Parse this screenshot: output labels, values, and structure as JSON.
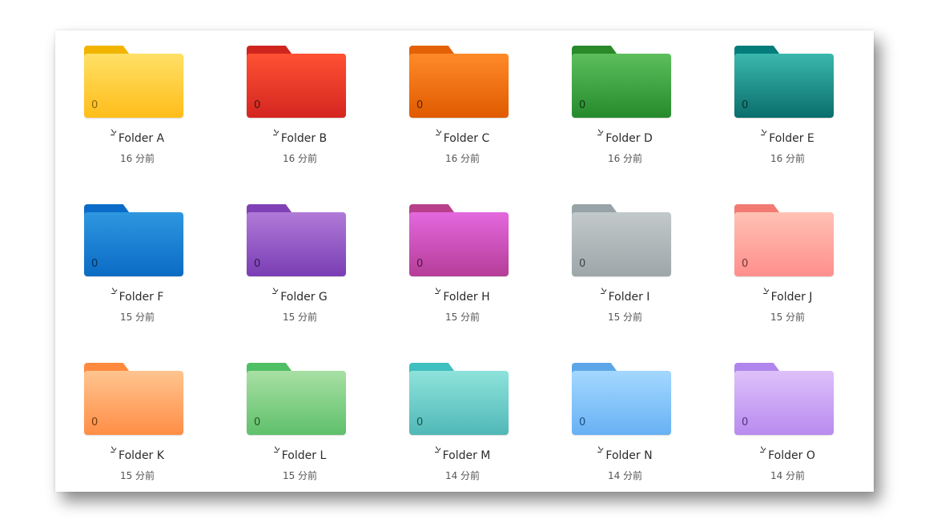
{
  "folders": [
    {
      "name": "Folder A",
      "time": "16 分前",
      "count": "0",
      "tab": "#f1b500",
      "top": "#ffe066",
      "bottom": "#ffbd1a",
      "text": "#7a5500"
    },
    {
      "name": "Folder B",
      "time": "16 分前",
      "count": "0",
      "tab": "#d0251f",
      "top": "#ff5133",
      "bottom": "#d42620",
      "text": "#2b1010"
    },
    {
      "name": "Folder C",
      "time": "16 分前",
      "count": "0",
      "tab": "#e46105",
      "top": "#ff8a28",
      "bottom": "#e05a00",
      "text": "#3a1a00"
    },
    {
      "name": "Folder D",
      "time": "16 分前",
      "count": "0",
      "tab": "#2a8a2a",
      "top": "#5cbf5c",
      "bottom": "#268a2c",
      "text": "#0b240b"
    },
    {
      "name": "Folder E",
      "time": "16 分前",
      "count": "0",
      "tab": "#047d7a",
      "top": "#3bb8ad",
      "bottom": "#0a6e6c",
      "text": "#022623"
    },
    {
      "name": "Folder F",
      "time": "15 分前",
      "count": "0",
      "tab": "#0a6cc8",
      "top": "#2e97e0",
      "bottom": "#0b6bc4",
      "text": "#04223f"
    },
    {
      "name": "Folder G",
      "time": "15 分前",
      "count": "0",
      "tab": "#8041b6",
      "top": "#b07ad8",
      "bottom": "#7a3db4",
      "text": "#23103a"
    },
    {
      "name": "Folder H",
      "time": "15 分前",
      "count": "0",
      "tab": "#b8408b",
      "top": "#e368de",
      "bottom": "#b53d98",
      "text": "#3a0f31"
    },
    {
      "name": "Folder I",
      "time": "15 分前",
      "count": "0",
      "tab": "#97a3a6",
      "top": "#c2c9cb",
      "bottom": "#9da6a8",
      "text": "#2d3436"
    },
    {
      "name": "Folder J",
      "time": "15 分前",
      "count": "0",
      "tab": "#f27a73",
      "top": "#ffc2b4",
      "bottom": "#ff8e8c",
      "text": "#5a2020"
    },
    {
      "name": "Folder K",
      "time": "15 分前",
      "count": "0",
      "tab": "#ff8a3d",
      "top": "#ffc48f",
      "bottom": "#ff8e46",
      "text": "#5a2a00"
    },
    {
      "name": "Folder L",
      "time": "15 分前",
      "count": "0",
      "tab": "#4fbf63",
      "top": "#a8e0a4",
      "bottom": "#5fc06b",
      "text": "#164016"
    },
    {
      "name": "Folder M",
      "time": "14 分前",
      "count": "0",
      "tab": "#3fbfbf",
      "top": "#8ee3db",
      "bottom": "#50b8b7",
      "text": "#0c3c3a"
    },
    {
      "name": "Folder N",
      "time": "14 分前",
      "count": "0",
      "tab": "#5ca6e8",
      "top": "#a3d8ff",
      "bottom": "#68b1f4",
      "text": "#0a3b73"
    },
    {
      "name": "Folder O",
      "time": "14 分前",
      "count": "0",
      "tab": "#b085ec",
      "top": "#dec0fa",
      "bottom": "#b88bef",
      "text": "#43206a"
    }
  ],
  "icons": {
    "sync": "sync-status-icon",
    "folder": "folder-icon"
  }
}
